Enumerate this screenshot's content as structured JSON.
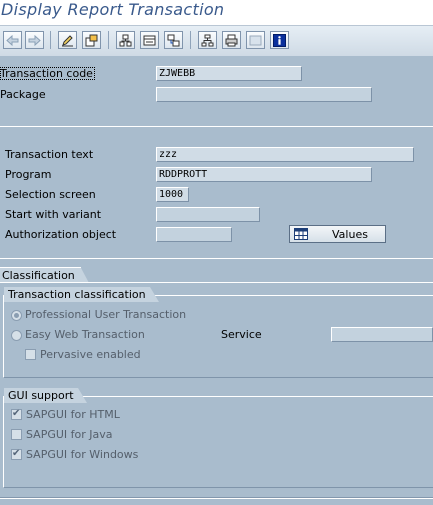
{
  "window": {
    "title": "Display Report Transaction"
  },
  "toolbar": {
    "buttons": [
      {
        "icon": "back-arrow-icon"
      },
      {
        "icon": "forward-arrow-icon"
      },
      {
        "icon": "display-change-pencil-icon"
      },
      {
        "icon": "other-object-icon"
      },
      {
        "icon": "hierarchy-icon"
      },
      {
        "icon": "where-used-icon"
      },
      {
        "icon": "navigation-icon"
      },
      {
        "icon": "tree-structure-icon"
      },
      {
        "icon": "print-icon"
      },
      {
        "icon": "layout-icon"
      },
      {
        "icon": "info-icon"
      }
    ]
  },
  "header": {
    "transaction_code_label": "Transaction code",
    "transaction_code_value": "ZJWEBB",
    "package_label": "Package",
    "package_value": ""
  },
  "details": {
    "transaction_text_label": "Transaction text",
    "transaction_text_value": "zzz",
    "program_label": "Program",
    "program_value": "RDDPROTT",
    "selection_screen_label": "Selection screen",
    "selection_screen_value": "1000",
    "start_variant_label": "Start with variant",
    "start_variant_value": "",
    "auth_object_label": "Authorization object",
    "auth_object_value": "",
    "values_button_label": "Values"
  },
  "classification": {
    "tab_label": "Classification",
    "transaction_classification_title": "Transaction classification",
    "professional_label": "Professional User Transaction",
    "professional_selected": true,
    "easy_web_label": "Easy Web Transaction",
    "easy_web_selected": false,
    "service_label": "Service",
    "service_value": "",
    "pervasive_label": "Pervasive enabled",
    "pervasive_checked": false
  },
  "gui_support": {
    "title": "GUI support",
    "html_label": "SAPGUI for HTML",
    "html_checked": true,
    "java_label": "SAPGUI for Java",
    "java_checked": false,
    "windows_label": "SAPGUI for Windows",
    "windows_checked": true
  }
}
